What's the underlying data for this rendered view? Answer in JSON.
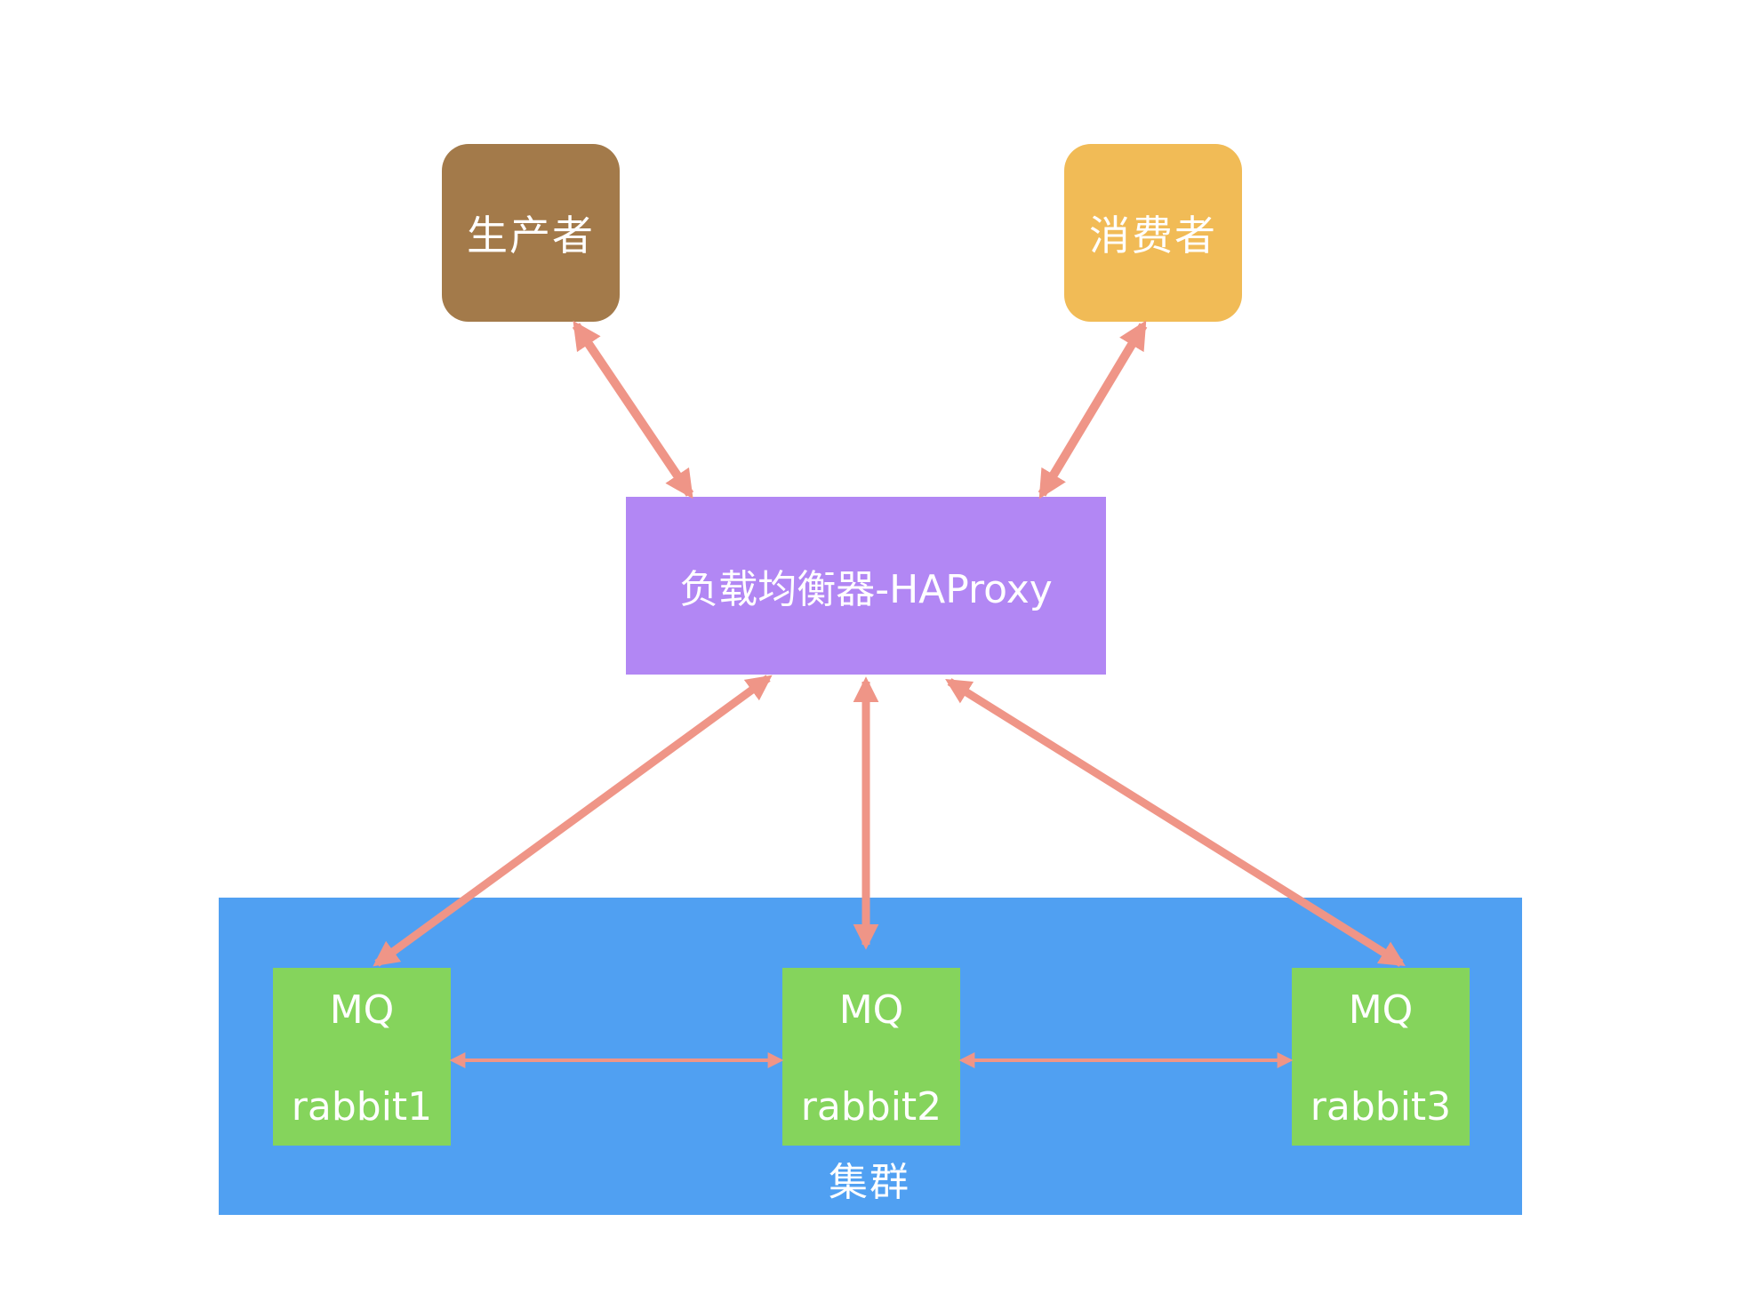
{
  "colors": {
    "producer": "#a37a4a",
    "consumer": "#f1bb56",
    "load_balancer": "#b287f4",
    "cluster": "#50a0f2",
    "mq_node": "#85d45c",
    "arrow": "#ef9587",
    "background": "#ffffff"
  },
  "nodes": {
    "producer": {
      "label": "生产者"
    },
    "consumer": {
      "label": "消费者"
    },
    "load_balancer": {
      "label": "负载均衡器-HAProxy"
    },
    "cluster": {
      "label": "集群"
    },
    "mq1": {
      "title": "MQ",
      "name": "rabbit1"
    },
    "mq2": {
      "title": "MQ",
      "name": "rabbit2"
    },
    "mq3": {
      "title": "MQ",
      "name": "rabbit3"
    }
  },
  "edges": [
    {
      "from": "producer",
      "to": "load_balancer",
      "direction": "both"
    },
    {
      "from": "consumer",
      "to": "load_balancer",
      "direction": "both"
    },
    {
      "from": "load_balancer",
      "to": "mq1",
      "direction": "both"
    },
    {
      "from": "load_balancer",
      "to": "mq2",
      "direction": "both"
    },
    {
      "from": "load_balancer",
      "to": "mq3",
      "direction": "both"
    },
    {
      "from": "mq1",
      "to": "mq2",
      "direction": "both"
    },
    {
      "from": "mq2",
      "to": "mq3",
      "direction": "both"
    }
  ]
}
